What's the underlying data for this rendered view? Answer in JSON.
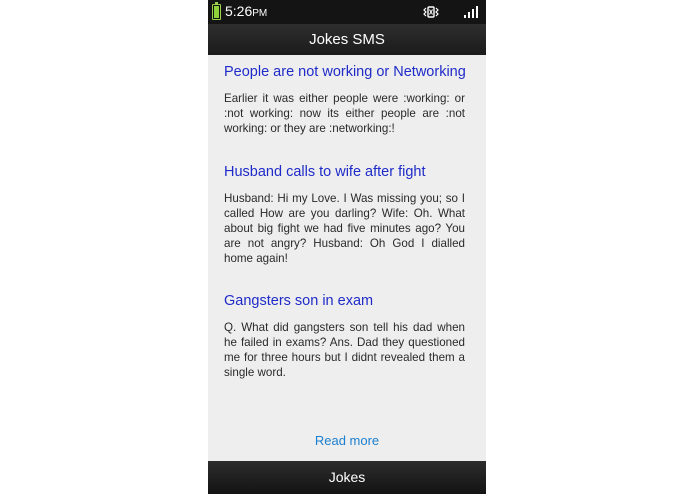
{
  "status_bar": {
    "time": "5:26",
    "ampm": "PM",
    "icons": [
      "battery-icon",
      "vibrate-icon",
      "signal-icon"
    ]
  },
  "header": {
    "title": "Jokes SMS"
  },
  "jokes": [
    {
      "title": "People are not working or Networking",
      "body": "Earlier it was either people were :working: or :not working: now its either people are :not working: or they are :networking:!"
    },
    {
      "title": "Husband calls to wife after fight",
      "body": "Husband: Hi my Love. I Was missing you; so I called How are you darling? Wife: Oh. What about big fight we had five minutes ago? You are not angry? Husband: Oh God I dialled home again!"
    },
    {
      "title": "Gangsters son in exam",
      "body": "Q. What did gangsters son tell his dad when he failed in exams? Ans. Dad they questioned me for three hours but I didnt revealed them a single word."
    }
  ],
  "read_more_label": "Read more",
  "bottom_bar": {
    "label": "Jokes"
  },
  "colors": {
    "joke_title": "#1f2bc9",
    "read_more": "#1b7fcf",
    "bar_background": "#1b1b1b",
    "content_background": "#eeeeee",
    "battery": "#8fd13b"
  }
}
